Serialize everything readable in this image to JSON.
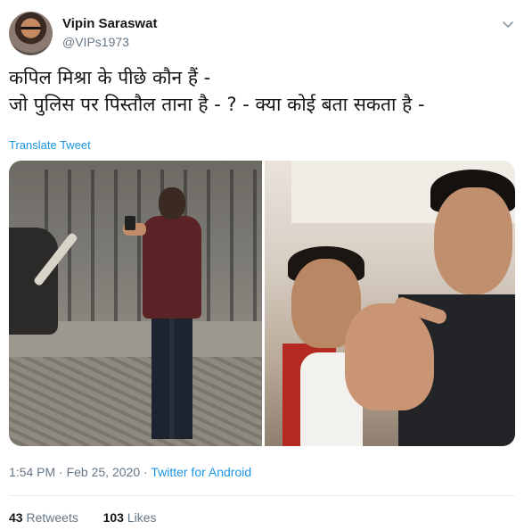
{
  "tweet": {
    "author_name": "Vipin Saraswat",
    "author_handle": "@VIPs1973",
    "text_lines": [
      "कपिल मिश्रा के पीछे कौन हैं -",
      "जो पुलिस पर पिस्तौल ताना है - ? - क्या कोई बता सकता है -"
    ],
    "translate_label": "Translate Tweet",
    "time": "1:54 PM",
    "date": "Feb 25, 2020",
    "separator": "·",
    "source": "Twitter for Android",
    "retweets_count": "43",
    "retweets_label": "Retweets",
    "likes_count": "103",
    "likes_label": "Likes"
  },
  "icons": {
    "menu_caret": "chevron-down-icon"
  },
  "colors": {
    "link": "#1b95e0",
    "muted": "#657786",
    "text": "#14171a",
    "divider": "#e6ecf0"
  }
}
